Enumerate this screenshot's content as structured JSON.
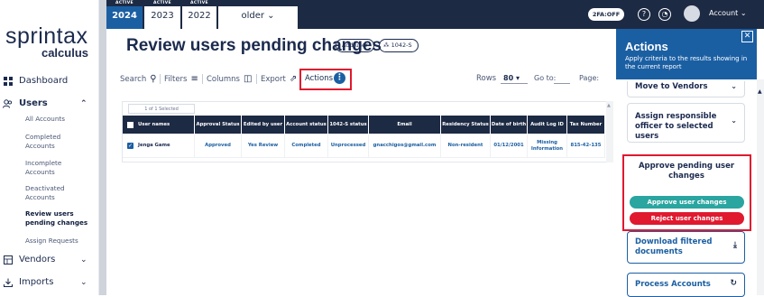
{
  "brand": {
    "name": "sprintax",
    "sub": "calculus"
  },
  "sidebar": {
    "dashboard": "Dashboard",
    "users": "Users",
    "user_items": [
      "All Accounts",
      "Completed Accounts",
      "Incomplete Accounts",
      "Deactivated Accounts",
      "Review users pending changes",
      "Assign Requests"
    ],
    "vendors": "Vendors",
    "imports": "Imports"
  },
  "topbar": {
    "years": [
      {
        "badge": "ACTIVE",
        "year": "2024",
        "active": true
      },
      {
        "badge": "ACTIVE",
        "year": "2023",
        "active": false
      },
      {
        "badge": "ACTIVE",
        "year": "2022",
        "active": false
      }
    ],
    "older": "older",
    "twofa": "2FA:OFF",
    "account": "Account"
  },
  "main": {
    "title": "Review users pending changes",
    "add_user": "Add user",
    "form_1042s": "1042-S"
  },
  "toolbar": {
    "search": "Search",
    "filters": "Filters",
    "columns": "Columns",
    "export": "Export",
    "actions": "Actions",
    "rows_label": "Rows",
    "rows_value": "80",
    "goto": "Go to:",
    "page": "Page:"
  },
  "table": {
    "selected": "1 of 1 Selected",
    "headers": [
      "User names",
      "Approval Status",
      "Edited by user",
      "Account status",
      "1042-S status",
      "Email",
      "Residency Status",
      "Date of birth",
      "Audit Log ID",
      "Tax Number"
    ],
    "rows": [
      [
        "Jenga Game",
        "Approved",
        "Yes Review",
        "Completed",
        "Unprocessed",
        "gnacchigos@gmail.com",
        "Non-resident",
        "01/12/2001",
        "Missing Information",
        "815-42-135"
      ]
    ]
  },
  "panel": {
    "title": "Actions",
    "description": "Apply criteria to the results showing in the current report",
    "move_vendors": "Move to Vendors",
    "assign_officer": "Assign responsible officer to selected users",
    "approve_title": "Approve pending user changes",
    "approve_btn": "Approve user changes",
    "reject_btn": "Reject user changes",
    "download": "Download filtered documents",
    "process": "Process Accounts"
  },
  "colors": {
    "navy": "#1d2a44",
    "blue": "#1b5fa3",
    "teal": "#2aa5a0",
    "red": "#e0192f"
  }
}
